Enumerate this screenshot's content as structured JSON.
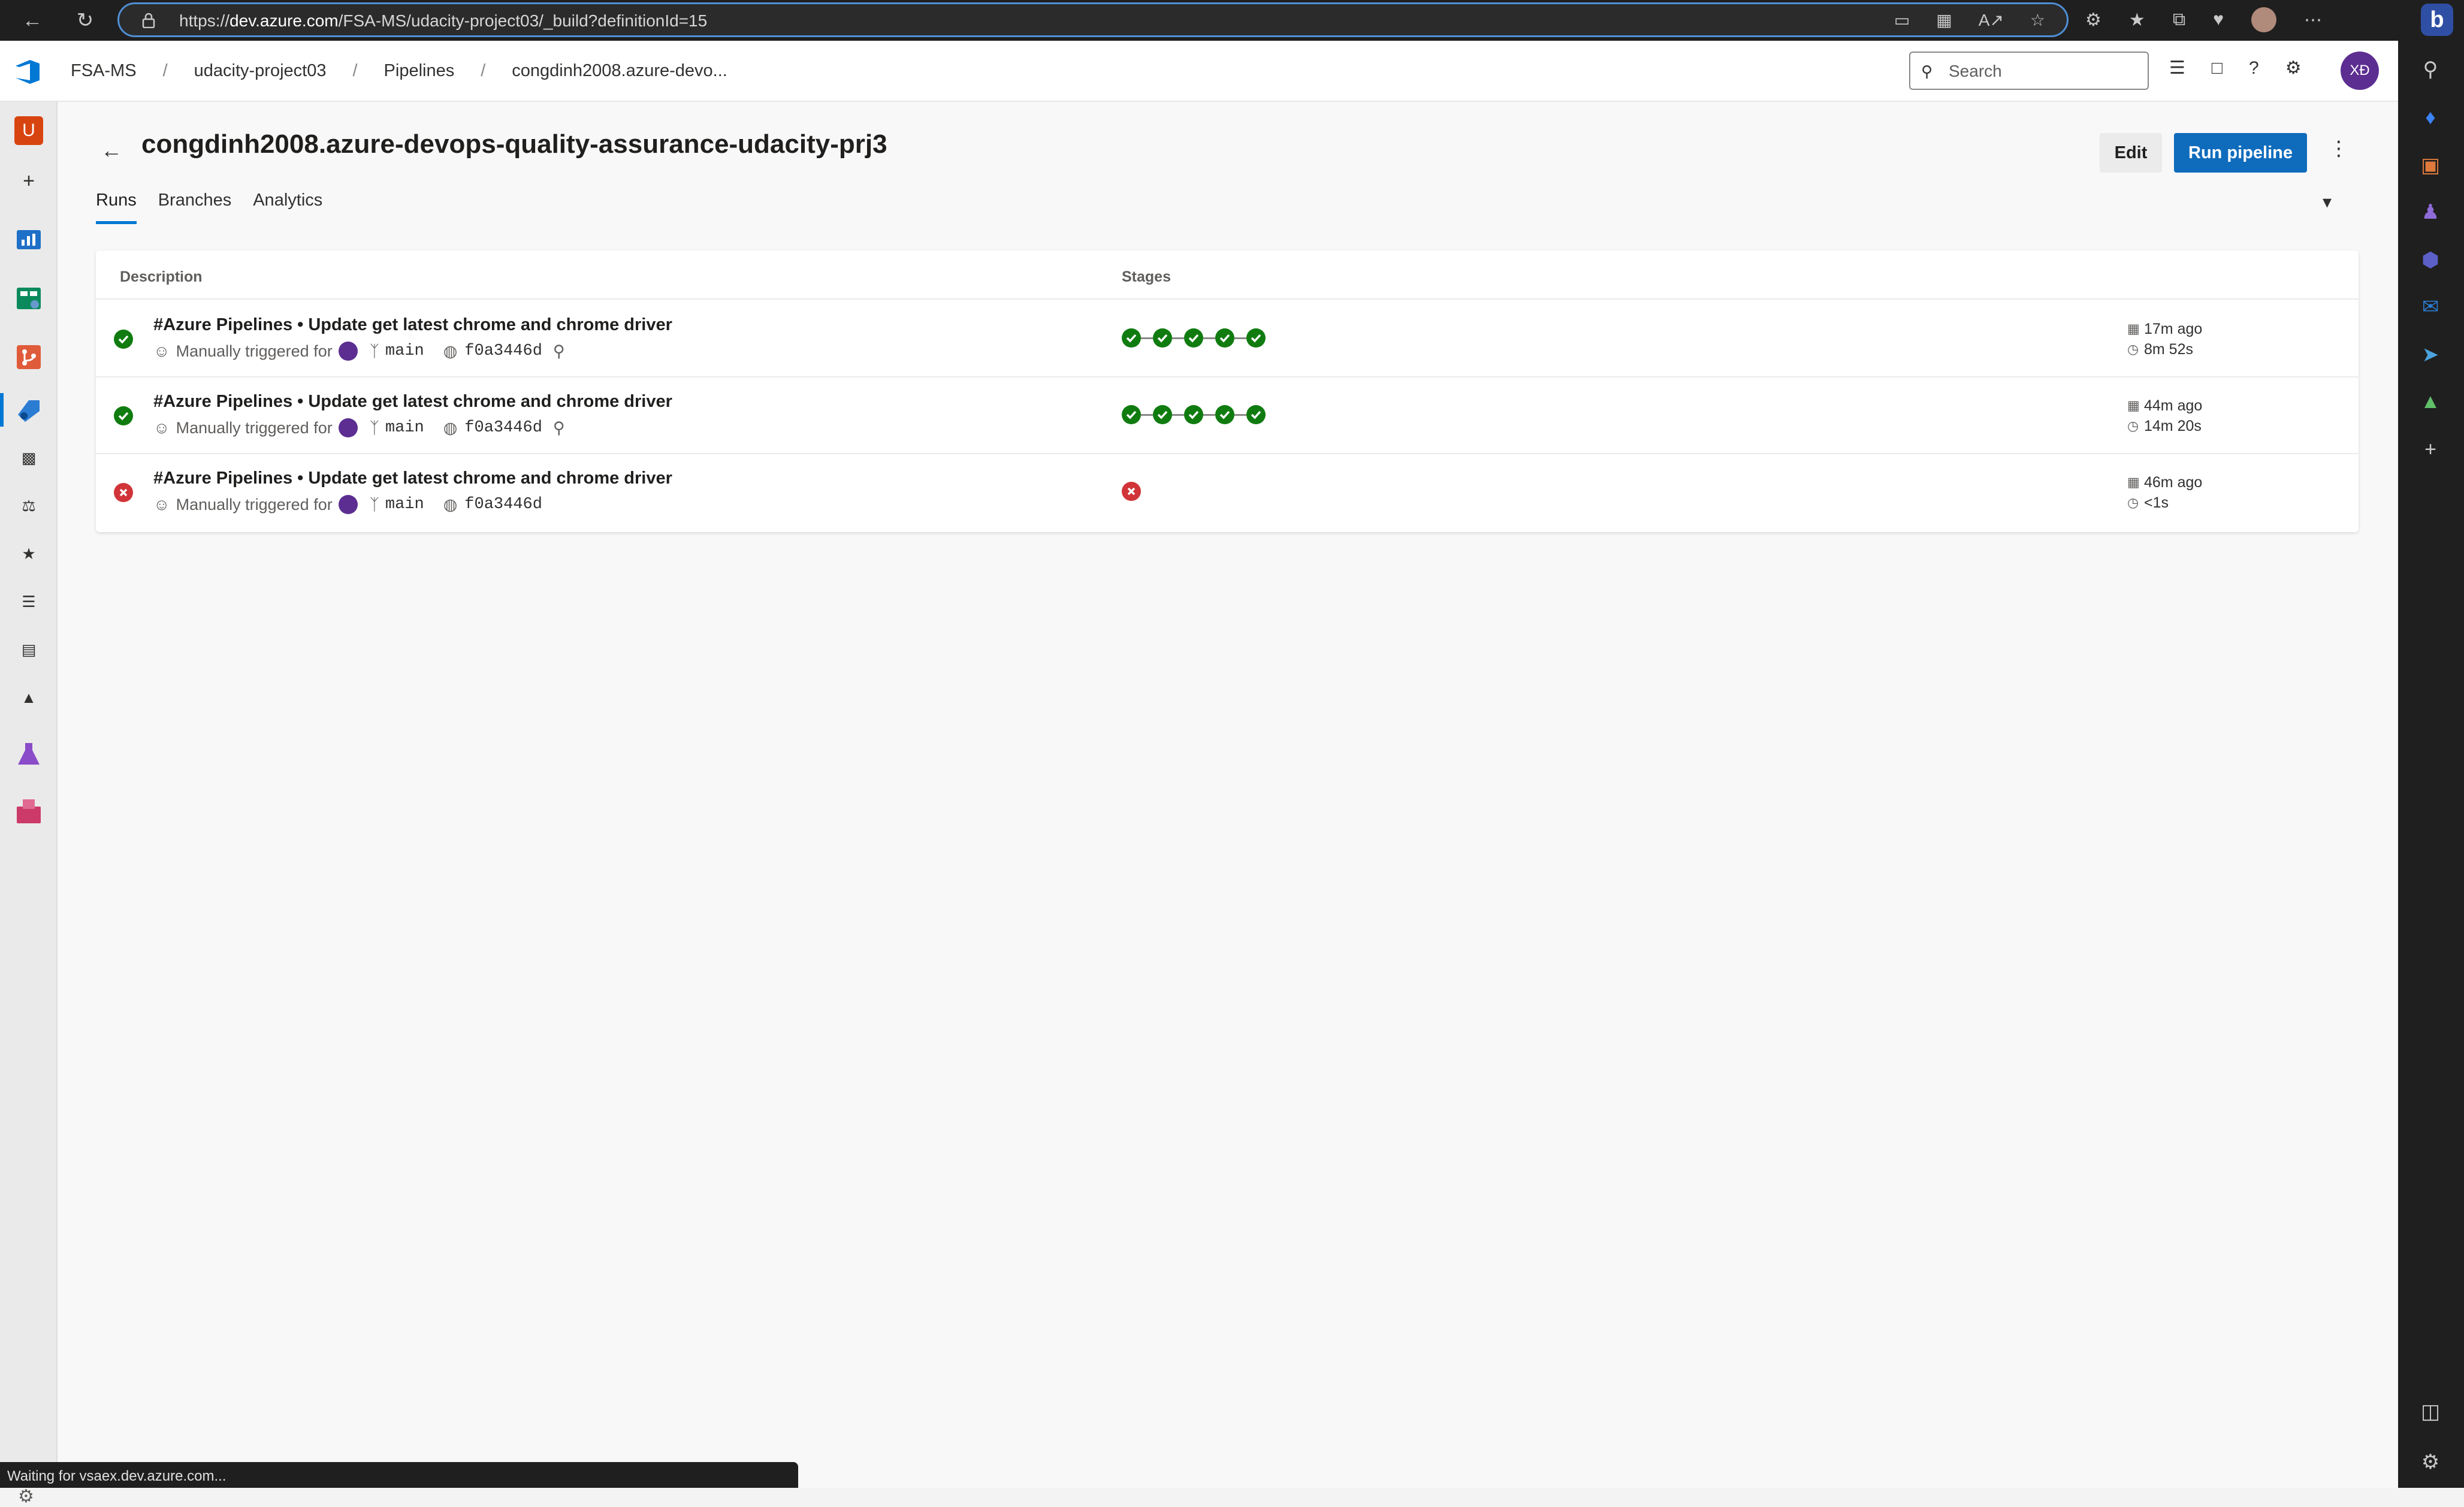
{
  "browser": {
    "url_prefix": "https://",
    "url_domain": "dev.azure.com",
    "url_path": "/FSA-MS/udacity-project03/_build?definitionId=15"
  },
  "header": {
    "breadcrumbs": [
      "FSA-MS",
      "udacity-project03",
      "Pipelines",
      "congdinh2008.azure-devo..."
    ],
    "search_placeholder": "Search",
    "avatar_initials": "XĐ"
  },
  "left_nav": {
    "project_badge": "U"
  },
  "page": {
    "title": "congdinh2008.azure-devops-quality-assurance-udacity-prj3",
    "edit_label": "Edit",
    "run_label": "Run pipeline",
    "tabs": [
      "Runs",
      "Branches",
      "Analytics"
    ],
    "active_tab": "Runs"
  },
  "table": {
    "columns": {
      "description": "Description",
      "stages": "Stages"
    },
    "runs": [
      {
        "status": "succeeded",
        "title": "#Azure Pipelines • Update get latest chrome and chrome driver",
        "trigger": "Manually triggered for",
        "branch": "main",
        "commit": "f0a3446d",
        "stages": [
          "succeeded",
          "succeeded",
          "succeeded",
          "succeeded",
          "succeeded"
        ],
        "ago": "17m ago",
        "duration": "8m 52s"
      },
      {
        "status": "succeeded",
        "title": "#Azure Pipelines • Update get latest chrome and chrome driver",
        "trigger": "Manually triggered for",
        "branch": "main",
        "commit": "f0a3446d",
        "stages": [
          "succeeded",
          "succeeded",
          "succeeded",
          "succeeded",
          "succeeded"
        ],
        "ago": "44m ago",
        "duration": "14m 20s"
      },
      {
        "status": "failed",
        "title": "#Azure Pipelines • Update get latest chrome and chrome driver",
        "trigger": "Manually triggered for",
        "branch": "main",
        "commit": "f0a3446d",
        "stages": [
          "failed"
        ],
        "ago": "46m ago",
        "duration": "<1s"
      }
    ]
  },
  "status_bar": "Waiting for vsaex.dev.azure.com...",
  "colors": {
    "accent": "#0f6cbd",
    "success": "#107c10",
    "failure": "#d13438",
    "avatar": "#5c2e91",
    "project_badge": "#d8440f"
  }
}
